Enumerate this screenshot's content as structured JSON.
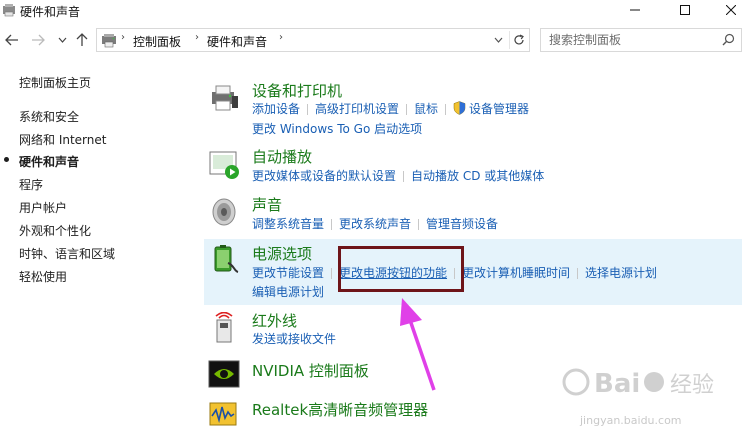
{
  "window": {
    "title": "硬件和声音"
  },
  "address": {
    "breadcrumbs": [
      "控制面板",
      "硬件和声音"
    ]
  },
  "search": {
    "placeholder": "搜索控制面板"
  },
  "sidebar": {
    "items": [
      {
        "label": "控制面板主页",
        "active": false
      },
      {
        "label": "系统和安全",
        "active": false
      },
      {
        "label": "网络和 Internet",
        "active": false
      },
      {
        "label": "硬件和声音",
        "active": true
      },
      {
        "label": "程序",
        "active": false
      },
      {
        "label": "用户帐户",
        "active": false
      },
      {
        "label": "外观和个性化",
        "active": false
      },
      {
        "label": "时钟、语言和区域",
        "active": false
      },
      {
        "label": "轻松使用",
        "active": false
      }
    ]
  },
  "categories": [
    {
      "title": "设备和打印机",
      "icon": "printer-icon",
      "links": [
        "添加设备",
        "高级打印机设置",
        "鼠标",
        "设备管理器",
        "更改 Windows To Go 启动选项"
      ]
    },
    {
      "title": "自动播放",
      "icon": "autoplay-icon",
      "links": [
        "更改媒体或设备的默认设置",
        "自动播放 CD 或其他媒体"
      ]
    },
    {
      "title": "声音",
      "icon": "speaker-icon",
      "links": [
        "调整系统音量",
        "更改系统声音",
        "管理音频设备"
      ]
    },
    {
      "title": "电源选项",
      "icon": "battery-icon",
      "links": [
        "更改节能设置",
        "更改电源按钮的功能",
        "更改计算机睡眠时间",
        "选择电源计划",
        "编辑电源计划"
      ]
    },
    {
      "title": "红外线",
      "icon": "infrared-icon",
      "links": [
        "发送或接收文件"
      ]
    },
    {
      "title": "NVIDIA 控制面板",
      "icon": "nvidia-icon",
      "links": []
    },
    {
      "title": "Realtek高清晰音频管理器",
      "icon": "realtek-icon",
      "links": []
    }
  ],
  "watermark": {
    "text": "jingyan.baidu.com"
  },
  "colors": {
    "link": "#1a5fb4",
    "category_title": "#1a7a1a",
    "highlight": "#e5f3fb",
    "annotation_box": "#6e1419",
    "annotation_arrow": "#e040e8"
  }
}
